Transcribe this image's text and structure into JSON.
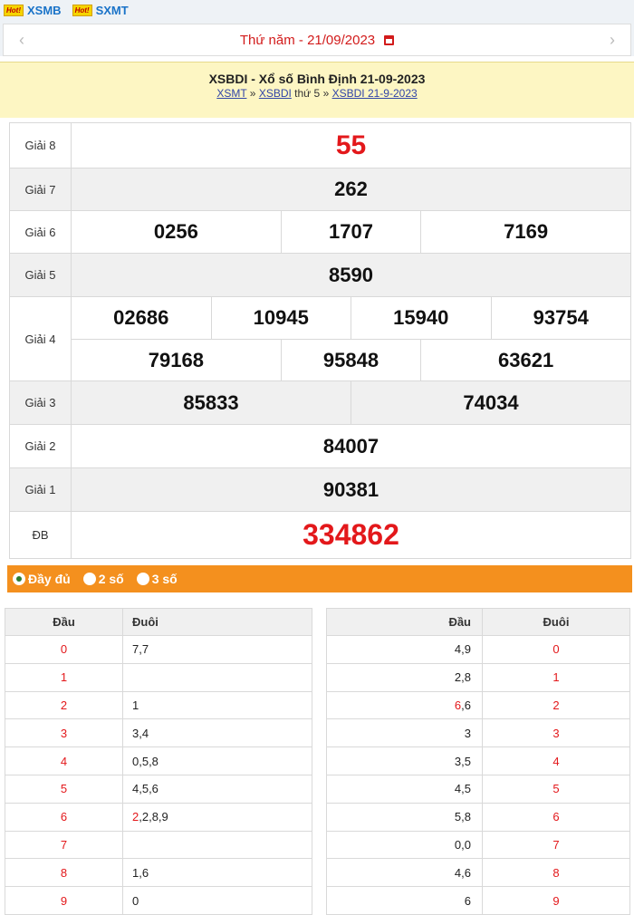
{
  "topbar": {
    "hot_badge": "Hot!",
    "links": [
      "XSMB",
      "SXMT"
    ]
  },
  "datebar": {
    "prev": "‹",
    "next": "›",
    "date_text": "Thứ năm -  21/09/2023"
  },
  "header": {
    "title": "XSBDI - Xổ số Bình Định 21-09-2023",
    "crumb1": "XSMT",
    "sep1": "»",
    "crumb2": "XSBDI",
    "crumb2_suffix": "thứ 5",
    "sep2": "»",
    "crumb3": "XSBDI 21-9-2023"
  },
  "prizes": {
    "g8": {
      "label": "Giải 8",
      "nums": [
        "55"
      ]
    },
    "g7": {
      "label": "Giải 7",
      "nums": [
        "262"
      ]
    },
    "g6": {
      "label": "Giải 6",
      "nums": [
        "0256",
        "1707",
        "7169"
      ]
    },
    "g5": {
      "label": "Giải 5",
      "nums": [
        "8590"
      ]
    },
    "g4": {
      "label": "Giải 4",
      "nums": [
        "02686",
        "10945",
        "15940",
        "93754",
        "79168",
        "95848",
        "63621"
      ]
    },
    "g3": {
      "label": "Giải 3",
      "nums": [
        "85833",
        "74034"
      ]
    },
    "g2": {
      "label": "Giải 2",
      "nums": [
        "84007"
      ]
    },
    "g1": {
      "label": "Giải 1",
      "nums": [
        "90381"
      ]
    },
    "db": {
      "label": "ĐB",
      "nums": [
        "334862"
      ]
    }
  },
  "options": [
    "Đầy đủ",
    "2 số",
    "3 số"
  ],
  "loto_left": {
    "headers": [
      "Đầu",
      "Đuôi"
    ],
    "rows": [
      {
        "dau": "0",
        "duoi": "7,7"
      },
      {
        "dau": "1",
        "duoi": ""
      },
      {
        "dau": "2",
        "duoi": "1"
      },
      {
        "dau": "3",
        "duoi": "3,4"
      },
      {
        "dau": "4",
        "duoi": "0,5,8"
      },
      {
        "dau": "5",
        "duoi": "4,5,6"
      },
      {
        "dau": "6",
        "duoi_red": "2",
        "duoi": ",2,8,9"
      },
      {
        "dau": "7",
        "duoi": ""
      },
      {
        "dau": "8",
        "duoi": "1,6"
      },
      {
        "dau": "9",
        "duoi": "0"
      }
    ]
  },
  "loto_right": {
    "headers": [
      "Đầu",
      "Đuôi"
    ],
    "rows": [
      {
        "dau": "4,9",
        "duoi": "0"
      },
      {
        "dau": "2,8",
        "duoi": "1"
      },
      {
        "dau_red": "6",
        "dau": ",6",
        "duoi": "2"
      },
      {
        "dau": "3",
        "duoi": "3"
      },
      {
        "dau": "3,5",
        "duoi": "4"
      },
      {
        "dau": "4,5",
        "duoi": "5"
      },
      {
        "dau": "5,8",
        "duoi": "6"
      },
      {
        "dau": "0,0",
        "duoi": "7"
      },
      {
        "dau": "4,6",
        "duoi": "8"
      },
      {
        "dau": "6",
        "duoi": "9"
      }
    ]
  },
  "colors": {
    "red": "#e3181b",
    "orange": "#f4901e",
    "header_bg": "#fdf6c3",
    "link_blue": "#1a73c8"
  }
}
